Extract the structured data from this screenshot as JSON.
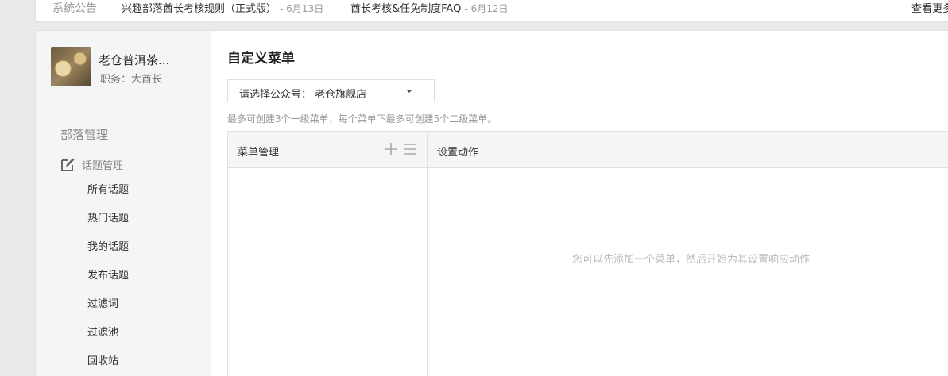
{
  "announcement": {
    "title": "系统公告",
    "items": [
      {
        "text": "兴趣部落酋长考核规则（正式版）",
        "date": "- 6月13日"
      },
      {
        "text": "酋长考核&任免制度FAQ",
        "date": "- 6月12日"
      }
    ],
    "more": "查看更多"
  },
  "profile": {
    "name": "老仓普洱茶...",
    "role": "职务：大酋长"
  },
  "sidebar": {
    "section": "部落管理",
    "group_label": "话题管理",
    "items": [
      "所有话题",
      "热门话题",
      "我的话题",
      "发布话题",
      "过滤词",
      "过滤池",
      "回收站"
    ]
  },
  "main": {
    "title": "自定义菜单",
    "select_label": "请选择公众号：",
    "select_value": "老仓旗舰店",
    "hint": "最多可创建3个一级菜单，每个菜单下最多可创建5个二级菜单。",
    "col_left_header": "菜单管理",
    "col_right_header": "设置动作",
    "empty_text": "您可以先添加一个菜单，然后开始为其设置响应动作"
  },
  "icons": {
    "group": "edit-icon",
    "add": "plus-icon",
    "sort": "list-icon",
    "dropdown": "caret-down-icon"
  }
}
